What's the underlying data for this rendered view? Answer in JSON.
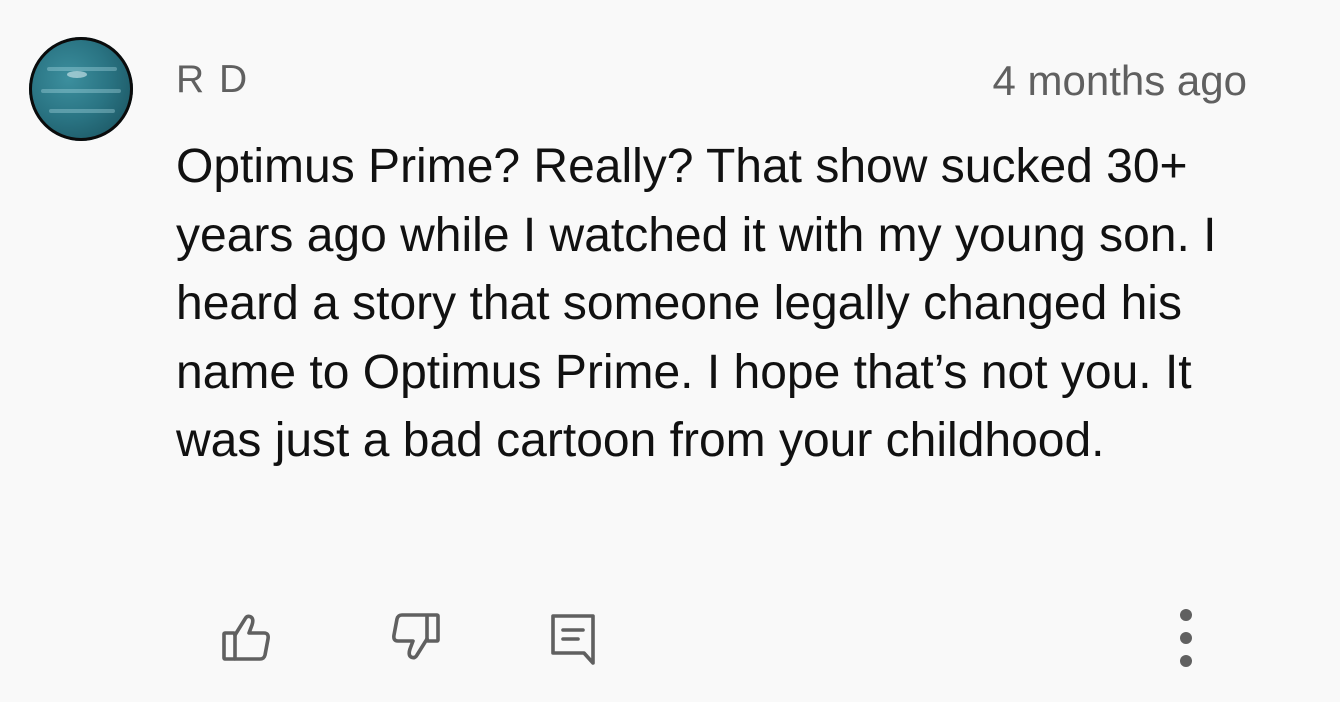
{
  "comment": {
    "author": "R D",
    "timestamp": "4 months ago",
    "text": "Optimus Prime? Really? That show sucked 30+ years ago while I watched it with my young son. I heard a story that someone legally changed his name to Optimus Prime. I hope that’s not you. It was just a bad cartoon from your childhood."
  },
  "actions": {
    "like_icon": "thumbs-up-icon",
    "dislike_icon": "thumbs-down-icon",
    "reply_icon": "comment-reply-icon",
    "more_icon": "more-vertical-icon"
  },
  "colors": {
    "background": "#f9f9f9",
    "text_primary": "#111111",
    "text_secondary": "#606060",
    "icon": "#606060",
    "avatar_planet": "#2a7483"
  }
}
